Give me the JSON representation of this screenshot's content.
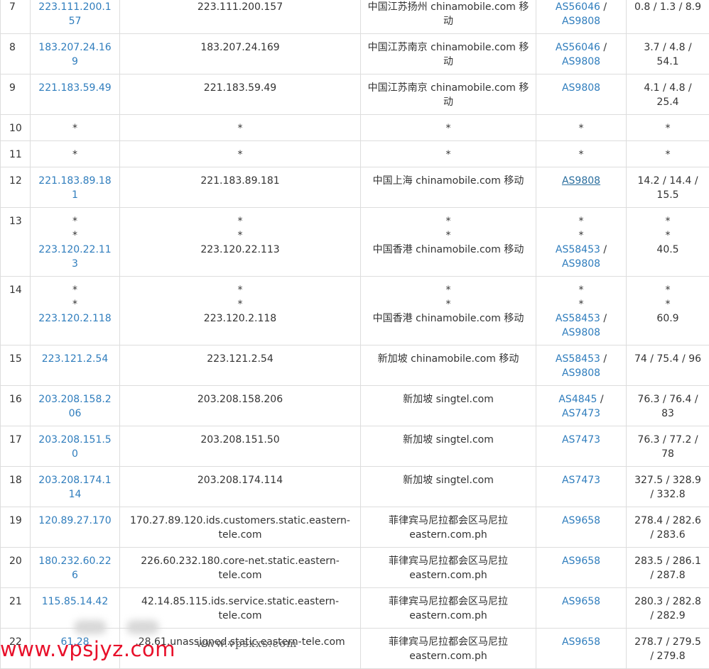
{
  "rows": [
    {
      "hop": "7",
      "ip": [
        "223.111.200.157"
      ],
      "host": [
        "223.111.200.157"
      ],
      "geo": [
        "中国江苏扬州 chinamobile.com 移动"
      ],
      "asn": [
        [
          "AS56046",
          "AS9808"
        ]
      ],
      "rtt": "0.8 / 1.3 / 8.9"
    },
    {
      "hop": "8",
      "ip": [
        "183.207.24.169"
      ],
      "host": [
        "183.207.24.169"
      ],
      "geo": [
        "中国江苏南京 chinamobile.com 移动"
      ],
      "asn": [
        [
          "AS56046",
          "AS9808"
        ]
      ],
      "rtt": "3.7 / 4.8 / 54.1"
    },
    {
      "hop": "9",
      "ip": [
        "221.183.59.49"
      ],
      "host": [
        "221.183.59.49"
      ],
      "geo": [
        "中国江苏南京 chinamobile.com 移动"
      ],
      "asn": [
        [
          "AS9808"
        ]
      ],
      "rtt": "4.1 / 4.8 / 25.4"
    },
    {
      "hop": "10",
      "ip": [
        "*"
      ],
      "host": [
        "*"
      ],
      "geo": [
        "*"
      ],
      "asn": [
        [
          "*"
        ]
      ],
      "rtt": "*"
    },
    {
      "hop": "11",
      "ip": [
        "*"
      ],
      "host": [
        "*"
      ],
      "geo": [
        "*"
      ],
      "asn": [
        [
          "*"
        ]
      ],
      "rtt": "*"
    },
    {
      "hop": "12",
      "ip": [
        "221.183.89.181"
      ],
      "host": [
        "221.183.89.181"
      ],
      "geo": [
        "中国上海 chinamobile.com 移动"
      ],
      "asn": [
        [
          "AS9808"
        ]
      ],
      "rtt": "14.2 / 14.4 / 15.5"
    },
    {
      "hop": "13",
      "ip": [
        "*",
        "*",
        "223.120.22.113"
      ],
      "host": [
        "*",
        "*",
        "223.120.22.113"
      ],
      "geo": [
        "*",
        "*",
        "中国香港 chinamobile.com 移动"
      ],
      "asn": [
        [
          "*"
        ],
        [
          "*"
        ],
        [
          "AS58453",
          "AS9808"
        ]
      ],
      "rtt": "* * 40.5"
    },
    {
      "hop": "14",
      "ip": [
        "*",
        "*",
        "223.120.2.118"
      ],
      "host": [
        "*",
        "*",
        "223.120.2.118"
      ],
      "geo": [
        "*",
        "*",
        "中国香港 chinamobile.com 移动"
      ],
      "asn": [
        [
          "*"
        ],
        [
          "*"
        ],
        [
          "AS58453",
          "AS9808"
        ]
      ],
      "rtt": "* * 60.9"
    },
    {
      "hop": "15",
      "ip": [
        "223.121.2.54"
      ],
      "host": [
        "223.121.2.54"
      ],
      "geo": [
        "新加坡 chinamobile.com 移动"
      ],
      "asn": [
        [
          "AS58453",
          "AS9808"
        ]
      ],
      "rtt": "74 / 75.4 / 96"
    },
    {
      "hop": "16",
      "ip": [
        "203.208.158.206"
      ],
      "host": [
        "203.208.158.206"
      ],
      "geo": [
        "新加坡 singtel.com"
      ],
      "asn": [
        [
          "AS4845",
          "AS7473"
        ]
      ],
      "rtt": "76.3 / 76.4 / 83"
    },
    {
      "hop": "17",
      "ip": [
        "203.208.151.50"
      ],
      "host": [
        "203.208.151.50"
      ],
      "geo": [
        "新加坡 singtel.com"
      ],
      "asn": [
        [
          "AS7473"
        ]
      ],
      "rtt": "76.3 / 77.2 / 78"
    },
    {
      "hop": "18",
      "ip": [
        "203.208.174.114"
      ],
      "host": [
        "203.208.174.114"
      ],
      "geo": [
        "新加坡 singtel.com"
      ],
      "asn": [
        [
          "AS7473"
        ]
      ],
      "rtt": "327.5 / 328.9 / 332.8"
    },
    {
      "hop": "19",
      "ip": [
        "120.89.27.170"
      ],
      "host": [
        "170.27.89.120.ids.customers.static.eastern-tele.com"
      ],
      "geo": [
        "菲律宾马尼拉都会区马尼拉 eastern.com.ph"
      ],
      "asn": [
        [
          "AS9658"
        ]
      ],
      "rtt": "278.4 / 282.6 / 283.6"
    },
    {
      "hop": "20",
      "ip": [
        "180.232.60.226"
      ],
      "host": [
        "226.60.232.180.core-net.static.eastern-tele.com"
      ],
      "geo": [
        "菲律宾马尼拉都会区马尼拉 eastern.com.ph"
      ],
      "asn": [
        [
          "AS9658"
        ]
      ],
      "rtt": "283.5 / 286.1 / 287.8"
    },
    {
      "hop": "21",
      "ip": [
        "115.85.14.42"
      ],
      "host": [
        "42.14.85.115.ids.service.static.eastern-tele.com"
      ],
      "geo": [
        "菲律宾马尼拉都会区马尼拉 eastern.com.ph"
      ],
      "asn": [
        [
          "AS9658"
        ]
      ],
      "rtt": "280.3 / 282.8 / 282.9"
    },
    {
      "hop": "22",
      "ip": [
        "61.28"
      ],
      "host": [
        ".28.61.unassigned.static.eastern-tele.com"
      ],
      "geo": [
        "菲律宾马尼拉都会区马尼拉 eastern.com.ph"
      ],
      "asn": [
        [
          "AS9658"
        ]
      ],
      "rtt": "278.7 / 279.5 / 279.8"
    }
  ],
  "watermark": {
    "red": "www.vpsjyz.com",
    "gray": "www.vpsxxs.com"
  },
  "colors": {
    "link": "#2f7dbd",
    "border": "#dddddd",
    "text": "#333333",
    "watermark_red": "#e8102a"
  }
}
